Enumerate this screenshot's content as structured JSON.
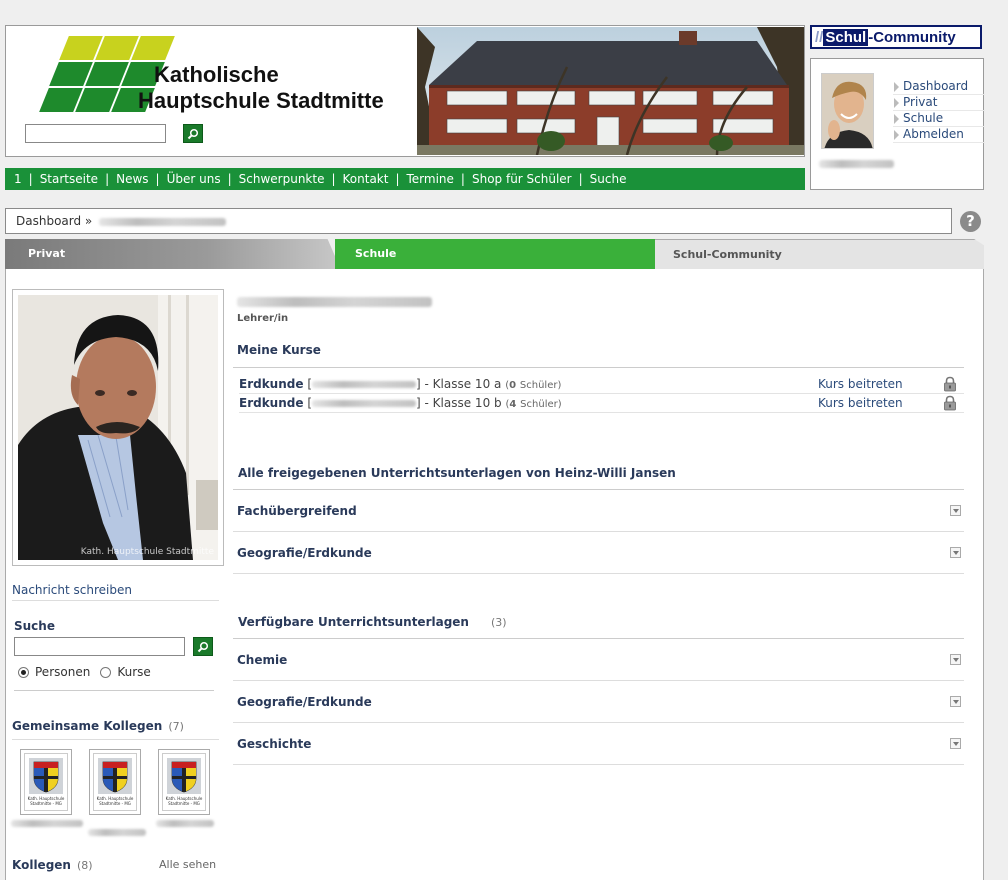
{
  "header": {
    "school_name_line1": "Katholische",
    "school_name_line2": "Hauptschule Stadtmitte",
    "search_value": "",
    "search_button_icon": "search-icon"
  },
  "topnav": {
    "items": [
      "1",
      "Startseite",
      "News",
      "Über uns",
      "Schwerpunkte",
      "Kontakt",
      "Termine",
      "Shop für Schüler",
      "Suche"
    ],
    "separator": "|",
    "background": "#1a9139"
  },
  "community": {
    "logo_slash": "//",
    "logo_schul": "Schul",
    "logo_dash": "-",
    "logo_community": "Community",
    "menu": [
      "Dashboard",
      "Privat",
      "Schule",
      "Abmelden"
    ]
  },
  "breadcrumb": {
    "root": "Dashboard »"
  },
  "help_icon": "?",
  "tabs": {
    "privat": "Privat",
    "schule": "Schule",
    "community": "Schul-Community",
    "active_color": "#3ab03a"
  },
  "profile": {
    "role": "Lehrer/in",
    "photo_caption": "Kath. Hauptschule Stadtmitte",
    "write_message": "Nachricht schreiben"
  },
  "left_search": {
    "title": "Suche",
    "value": "",
    "option_persons": "Personen",
    "option_courses": "Kurse",
    "selected": "Personen"
  },
  "common_colleagues": {
    "title": "Gemeinsame Kollegen",
    "count": "(7)",
    "crest_text": "Kath. Hauptschule Stadtmitte - MG"
  },
  "colleagues": {
    "title": "Kollegen",
    "count": "(8)",
    "see_all": "Alle sehen"
  },
  "courses": {
    "title": "Meine Kurse",
    "rows": [
      {
        "subject": "Erdkunde",
        "bracket_open": "[",
        "bracket_close": "]",
        "class": "- Klasse 10 a",
        "count_open": "(",
        "count": "0",
        "count_label": "Schüler)",
        "action": "Kurs beitreten"
      },
      {
        "subject": "Erdkunde",
        "bracket_open": "[",
        "bracket_close": "]",
        "class": "- Klasse 10 b",
        "count_open": "(",
        "count": "4",
        "count_label": "Schüler)",
        "action": "Kurs beitreten"
      }
    ]
  },
  "shared_materials": {
    "title": "Alle freigegebenen Unterrichtsunterlagen von Heinz-Willi Jansen",
    "items": [
      "Fachübergreifend",
      "Geografie/Erdkunde"
    ]
  },
  "available_materials": {
    "title": "Verfügbare Unterrichtsunterlagen",
    "count": "(3)",
    "items": [
      "Chemie",
      "Geografie/Erdkunde",
      "Geschichte"
    ]
  }
}
